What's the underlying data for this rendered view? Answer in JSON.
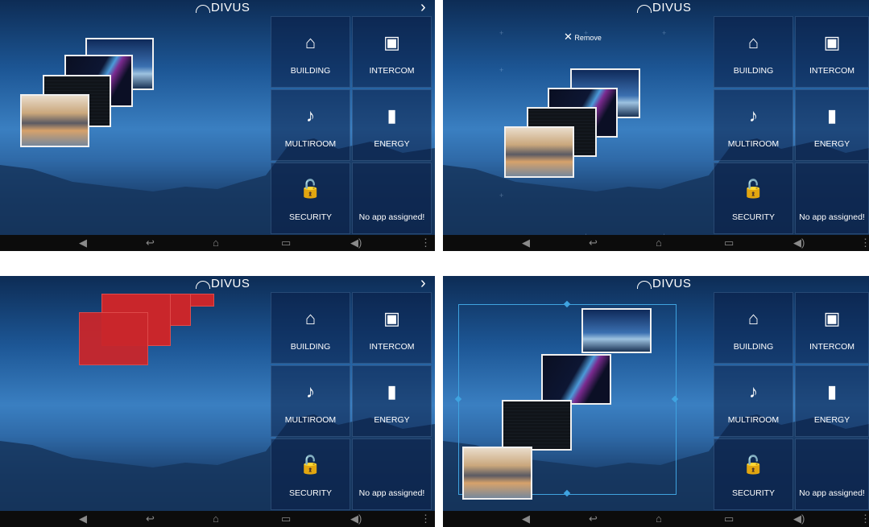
{
  "app": {
    "brand": "DIVUS",
    "chevron": "›",
    "remove_label": "Remove",
    "remove_icon": "close-icon"
  },
  "tiles": [
    {
      "label": "BUILDING",
      "icon": "house-icon",
      "glyph": "⌂"
    },
    {
      "label": "INTERCOM",
      "icon": "intercom-icon",
      "glyph": "▣"
    },
    {
      "label": "MULTIROOM",
      "icon": "music-icon",
      "glyph": "♪"
    },
    {
      "label": "ENERGY",
      "icon": "energy-bars-icon",
      "glyph": "▮"
    },
    {
      "label": "SECURITY",
      "icon": "padlock-icon",
      "glyph": "🔓"
    },
    {
      "label": "No app assigned!",
      "icon": "",
      "glyph": ""
    }
  ],
  "navbar": [
    {
      "icon": "volume-down-icon",
      "glyph": "◀"
    },
    {
      "icon": "back-icon",
      "glyph": "↩"
    },
    {
      "icon": "home-icon",
      "glyph": "⌂"
    },
    {
      "icon": "recent-apps-icon",
      "glyph": "▭"
    },
    {
      "icon": "volume-up-icon",
      "glyph": "◀)"
    },
    {
      "icon": "menu-icon",
      "glyph": "⋮"
    }
  ],
  "colors": {
    "accent": "#3fa3e0",
    "drag_red": "#c9262b",
    "tile_bg": "#0a1e46",
    "navbar": "#0c0c0c"
  }
}
